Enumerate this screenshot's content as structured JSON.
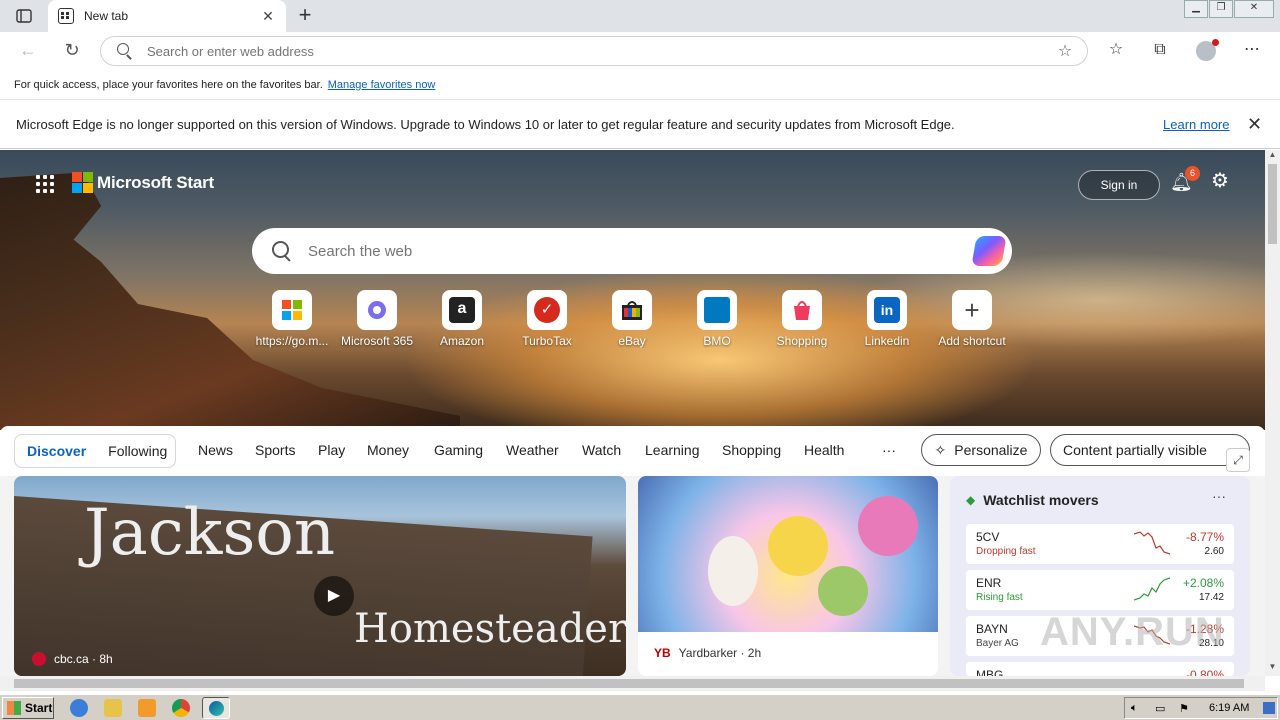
{
  "browser": {
    "tab_title": "New tab",
    "address_placeholder": "Search or enter web address",
    "favorites_bar_text": "For quick access, place your favorites here on the favorites bar.",
    "favorites_bar_link": "Manage favorites now"
  },
  "infobar": {
    "message": "Microsoft Edge is no longer supported on this version of Windows. Upgrade to Windows 10 or later to get regular feature and security updates from Microsoft Edge.",
    "learn_more": "Learn more"
  },
  "start": {
    "brand": "Microsoft Start",
    "sign_in": "Sign in",
    "notification_count": "6",
    "search_placeholder": "Search the web",
    "shortcuts": [
      {
        "label": "https://go.m...",
        "icon": "windows-logo"
      },
      {
        "label": "Microsoft 365",
        "icon": "m365-logo"
      },
      {
        "label": "Amazon",
        "icon": "amazon-logo"
      },
      {
        "label": "TurboTax",
        "icon": "turbotax-logo"
      },
      {
        "label": "eBay",
        "icon": "ebay-logo"
      },
      {
        "label": "BMO",
        "icon": "bmo-logo"
      },
      {
        "label": "Shopping",
        "icon": "shopping-bag"
      },
      {
        "label": "Linkedin",
        "icon": "linkedin-logo"
      },
      {
        "label": "Add shortcut",
        "icon": "plus"
      }
    ]
  },
  "feed_nav": {
    "discover": "Discover",
    "following": "Following",
    "tabs": [
      "News",
      "Sports",
      "Play",
      "Money",
      "Gaming",
      "Weather",
      "Watch",
      "Learning",
      "Shopping",
      "Health"
    ],
    "more": "···",
    "personalize": "Personalize",
    "visibility": "Content partially visible"
  },
  "cards": {
    "main": {
      "source": "cbc.ca · 8h",
      "sign_line1": "Jackson",
      "sign_line2": "Homesteaders"
    },
    "mid": {
      "source": "Yardbarker · 2h",
      "source_badge": "YB"
    }
  },
  "watchlist": {
    "title": "Watchlist movers",
    "more": "···",
    "stocks": [
      {
        "symbol": "5CV",
        "sub": "Dropping fast",
        "change": "-8.77%",
        "price": "2.60",
        "direction": "down"
      },
      {
        "symbol": "ENR",
        "sub": "Rising fast",
        "change": "+2.08%",
        "price": "17.42",
        "direction": "up"
      },
      {
        "symbol": "BAYN",
        "sub": "Bayer AG",
        "change": "-1.28%",
        "price": "28.10",
        "direction": "down"
      },
      {
        "symbol": "MBG",
        "sub": "",
        "change": "-0.80%",
        "price": "",
        "direction": "down"
      }
    ]
  },
  "taskbar": {
    "start": "Start",
    "clock": "6:19 AM"
  },
  "watermark": "ANY.RUN",
  "colors": {
    "accent": "#0b62c4",
    "down": "#c0392b",
    "up": "#2c9b3a"
  }
}
